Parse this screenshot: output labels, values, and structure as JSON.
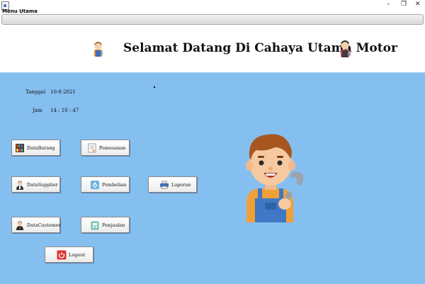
{
  "window": {
    "title": "Menu Utama",
    "minimize": "–",
    "restore": "❐",
    "close": "✕"
  },
  "header": {
    "title": "Selamat Datang Di Cahaya Utama Motor"
  },
  "info": {
    "date_label": "Tanggal",
    "date_value": "10-8-2021",
    "time_label": "Jam",
    "time_value": "14 : 10 : 47"
  },
  "buttons": {
    "data_barang": "DataBarang",
    "pemesanan": "Pemesanan",
    "data_supplier": "DataSupplier",
    "pembelian": "Pembelian",
    "laporan": "Laporan",
    "data_customer": "DataCustomer",
    "penjualan": "Penjualan",
    "logout": "Logout"
  },
  "icons": {
    "data_barang": "bookshelf-icon",
    "pemesanan": "document-icon",
    "data_supplier": "supplier-person-icon",
    "pembelian": "purchase-icon",
    "laporan": "printer-icon",
    "data_customer": "customer-person-icon",
    "penjualan": "sales-icon",
    "logout": "power-icon",
    "header_left": "mechanic-small-icon",
    "header_right": "mechanic-small-icon",
    "mascot": "mechanic-mascot-icon"
  },
  "colors": {
    "panel_bg": "#85bff0",
    "logout_red": "#e0312e"
  }
}
